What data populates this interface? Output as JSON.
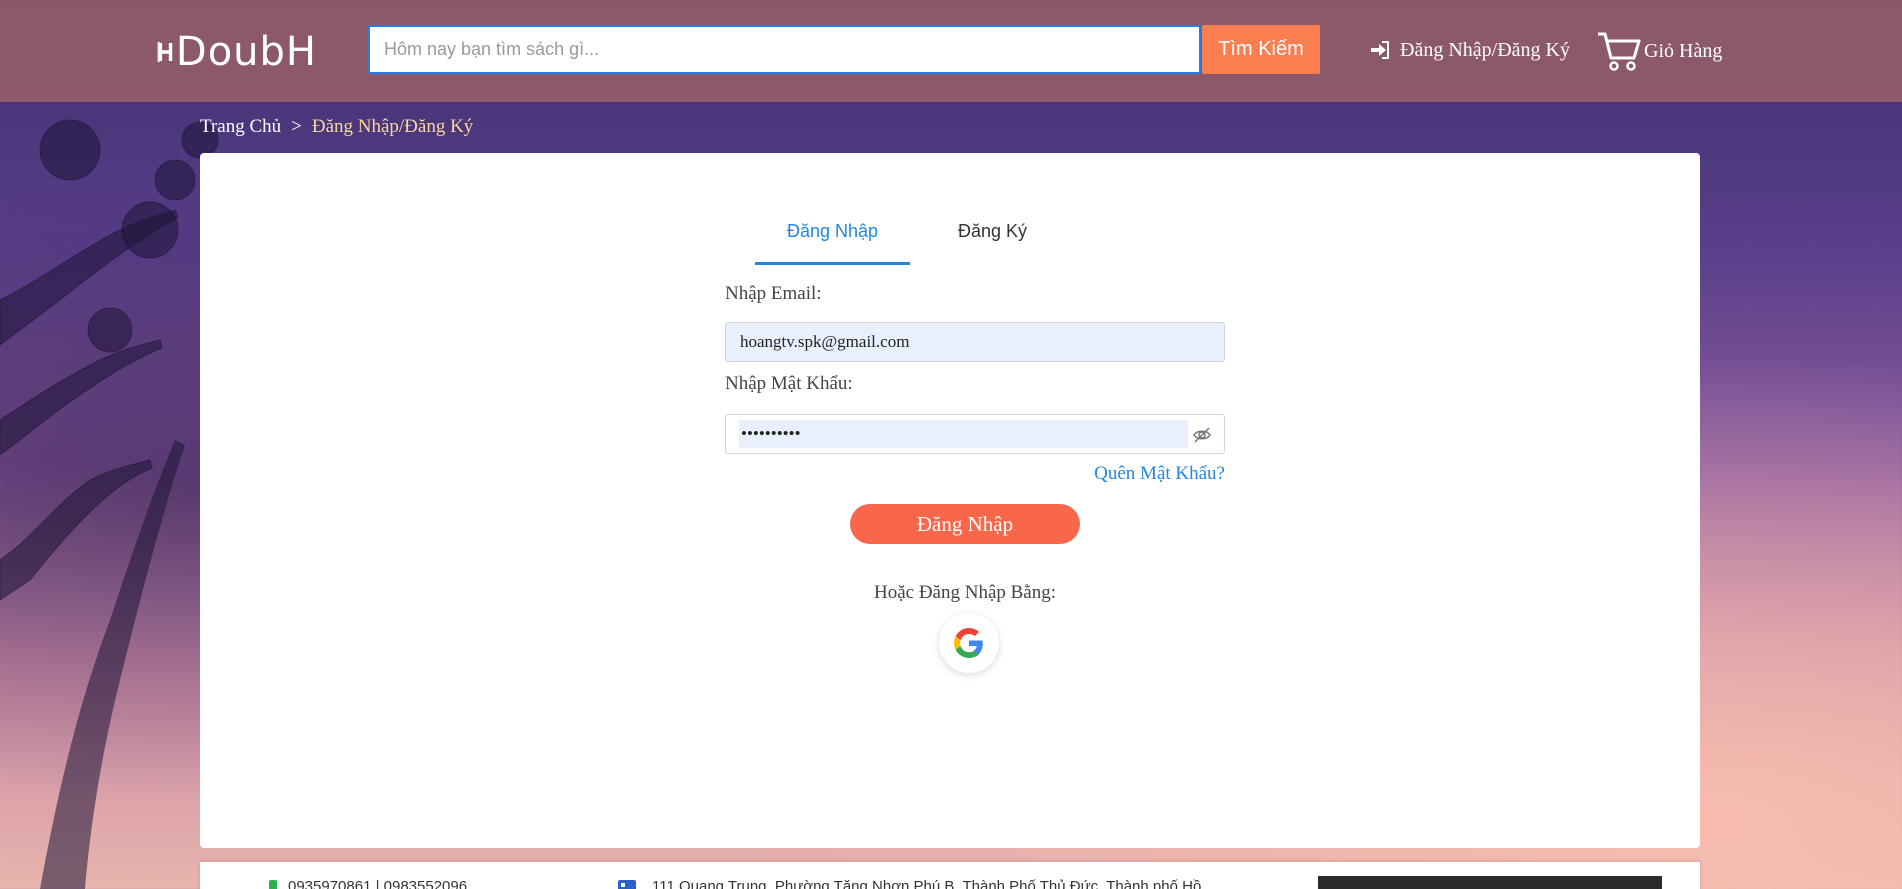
{
  "header": {
    "logo_text": "DoubH",
    "search_placeholder": "Hôm nay bạn tìm sách gì...",
    "search_button": "Tìm Kiếm",
    "login_link": "Đăng Nhập/Đăng Ký",
    "cart_link": "Giỏ Hàng"
  },
  "breadcrumb": {
    "home": "Trang Chủ",
    "separator": ">",
    "current": "Đăng Nhập/Đăng Ký"
  },
  "tabs": {
    "login": "Đăng Nhập",
    "register": "Đăng Ký",
    "active": "login"
  },
  "form": {
    "email_label": "Nhập Email:",
    "email_value": "hoangtv.spk@gmail.com",
    "password_label": "Nhập Mật Khẩu:",
    "password_value": "••••••••••",
    "forgot_link": "Quên Mật Khẩu?",
    "submit_button": "Đăng Nhập",
    "alt_login_label": "Hoặc Đăng Nhập Bằng:"
  },
  "footer": {
    "phone": "0935970861 | 0983552096",
    "address": "111 Quang Trung, Phường Tăng Nhơn Phú B, Thành Phố Thủ Đức, Thành phố Hồ"
  },
  "colors": {
    "accent_orange": "#fb7e51",
    "submit_red": "#f86749",
    "link_blue": "#1f87e0",
    "header_bg": "#965f69"
  }
}
